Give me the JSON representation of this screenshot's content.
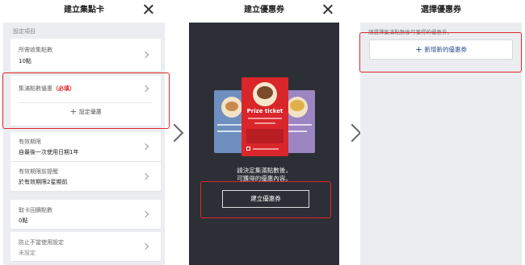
{
  "panel1": {
    "title": "建立集點卡",
    "section_label": "設定項目",
    "points_needed": {
      "label": "所需收集點數",
      "value": "10點"
    },
    "reward": {
      "label": "集滿點數優惠",
      "required": "（必填）",
      "add_label": "設定優惠"
    },
    "validity": {
      "label": "有效期限",
      "value": "自最後一次使用日期1年"
    },
    "reminder": {
      "label": "有效期限前提醒",
      "value": "於有效期限2星期前"
    },
    "bonus": {
      "label": "取卡回饋點數",
      "value": "0點"
    },
    "prevent": {
      "label": "防止不當使用設定",
      "value": "未設定"
    }
  },
  "panel2": {
    "title": "建立優惠券",
    "ticket_title": "Prize ticket",
    "instruction_line1": "請決定集滿點數後，",
    "instruction_line2": "可獲得的優惠內容。",
    "button_label": "建立優惠券"
  },
  "panel3": {
    "title": "選擇優惠券",
    "hint": "請選擇集滿點數後可獲得的優惠券。",
    "button_label": "新增新的優惠券"
  },
  "colors": {
    "accent_red": "#e0252a",
    "dark_bg": "#2c2f36",
    "link_blue": "#2a4e8f"
  },
  "icons": [
    "close-icon",
    "chevron-right-icon",
    "plus-icon",
    "arrow-right-icon"
  ]
}
